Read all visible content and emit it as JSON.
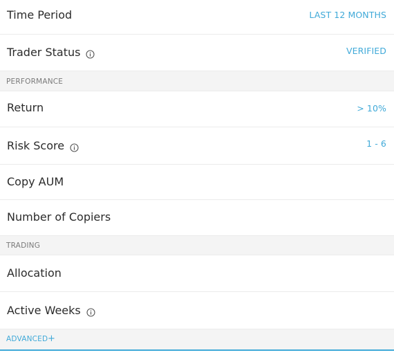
{
  "filters": {
    "time_period": {
      "label": "Time Period",
      "value": "LAST 12 MONTHS"
    },
    "trader_status": {
      "label": "Trader Status",
      "value": "VERIFIED"
    }
  },
  "performance": {
    "title": "PERFORMANCE",
    "return": {
      "label": "Return",
      "value": "> 10%"
    },
    "risk_score": {
      "label": "Risk Score",
      "value": "1 - 6"
    },
    "copy_aum": {
      "label": "Copy AUM"
    },
    "number_of_copiers": {
      "label": "Number of Copiers"
    }
  },
  "trading": {
    "title": "TRADING",
    "allocation": {
      "label": "Allocation"
    },
    "active_weeks": {
      "label": "Active Weeks"
    }
  },
  "advanced": {
    "label": "ADVANCED",
    "icon": "plus-icon"
  },
  "colors": {
    "accent": "#3fa9d8",
    "section_bg": "#f4f4f4",
    "text": "#2b2b2b",
    "muted": "#7a7a7a"
  }
}
